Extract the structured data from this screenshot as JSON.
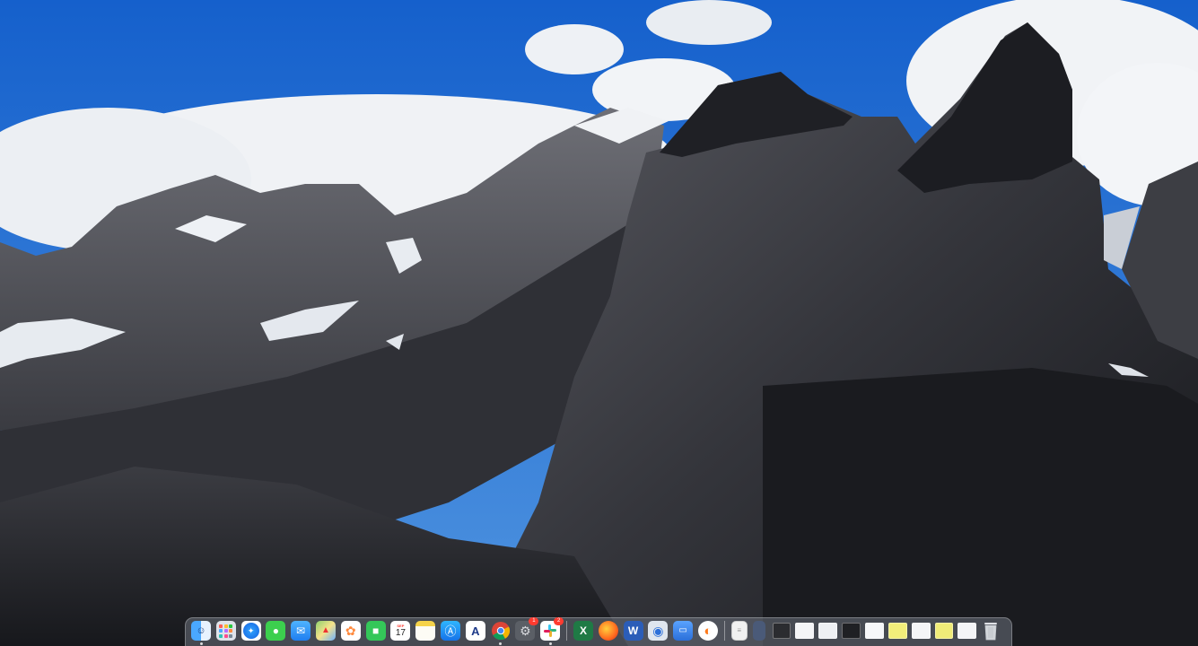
{
  "desktop": {
    "wallpaper": "Mountain peaks with snow and clouds under a blue sky",
    "colors": {
      "sky_top": "#1c6fd6",
      "sky_bottom": "#4b8fde",
      "cloud": "#f2f4f7",
      "rock_dark": "#1e1f24",
      "rock_mid": "#4a4b52",
      "snow": "#e9edf2"
    }
  },
  "dock": {
    "apps": [
      {
        "id": "finder",
        "icon": "finder-icon",
        "running": true
      },
      {
        "id": "launchpad",
        "icon": "launchpad-icon",
        "running": false
      },
      {
        "id": "safari",
        "icon": "safari-icon",
        "running": false
      },
      {
        "id": "messages",
        "icon": "messages-icon",
        "running": false
      },
      {
        "id": "mail",
        "icon": "mail-icon",
        "running": false
      },
      {
        "id": "maps",
        "icon": "maps-icon",
        "running": false
      },
      {
        "id": "photos",
        "icon": "photos-icon",
        "running": false
      },
      {
        "id": "facetime",
        "icon": "facetime-icon",
        "running": false
      },
      {
        "id": "calendar",
        "icon": "calendar-icon",
        "month": "SEP",
        "day": "17",
        "running": false
      },
      {
        "id": "notes",
        "icon": "notes-icon",
        "running": false
      },
      {
        "id": "app-store",
        "icon": "app-store-icon",
        "running": false
      },
      {
        "id": "dictionary",
        "icon": "dictionary-icon",
        "running": false
      },
      {
        "id": "chrome",
        "icon": "chrome-icon",
        "running": true
      },
      {
        "id": "system-preferences",
        "icon": "system-preferences-icon",
        "badge": "1",
        "running": false
      },
      {
        "id": "slack",
        "icon": "slack-icon",
        "badge": "2",
        "running": true
      },
      {
        "id": "excel",
        "icon": "excel-icon",
        "running": false
      },
      {
        "id": "firefox",
        "icon": "firefox-icon",
        "running": false
      },
      {
        "id": "word",
        "icon": "word-icon",
        "running": false
      },
      {
        "id": "preview",
        "icon": "preview-icon",
        "running": false
      },
      {
        "id": "screen-sharing",
        "icon": "screen-sharing-icon",
        "running": false
      },
      {
        "id": "vpn",
        "icon": "vpn-icon",
        "running": false
      }
    ],
    "minimized": [
      {
        "id": "document",
        "icon": "document-icon"
      },
      {
        "id": "window-1",
        "icon": "window-thumbnail-icon"
      },
      {
        "id": "window-2",
        "icon": "window-thumbnail-icon"
      },
      {
        "id": "window-3",
        "icon": "window-thumbnail-icon"
      },
      {
        "id": "window-4",
        "icon": "window-thumbnail-icon"
      },
      {
        "id": "window-5",
        "icon": "window-thumbnail-icon"
      },
      {
        "id": "window-6",
        "icon": "window-thumbnail-icon"
      },
      {
        "id": "window-7",
        "icon": "window-thumbnail-icon"
      },
      {
        "id": "window-8",
        "icon": "window-thumbnail-icon"
      },
      {
        "id": "window-9",
        "icon": "window-thumbnail-icon"
      },
      {
        "id": "window-10",
        "icon": "window-thumbnail-icon"
      }
    ],
    "trash": {
      "icon": "trash-icon"
    }
  }
}
